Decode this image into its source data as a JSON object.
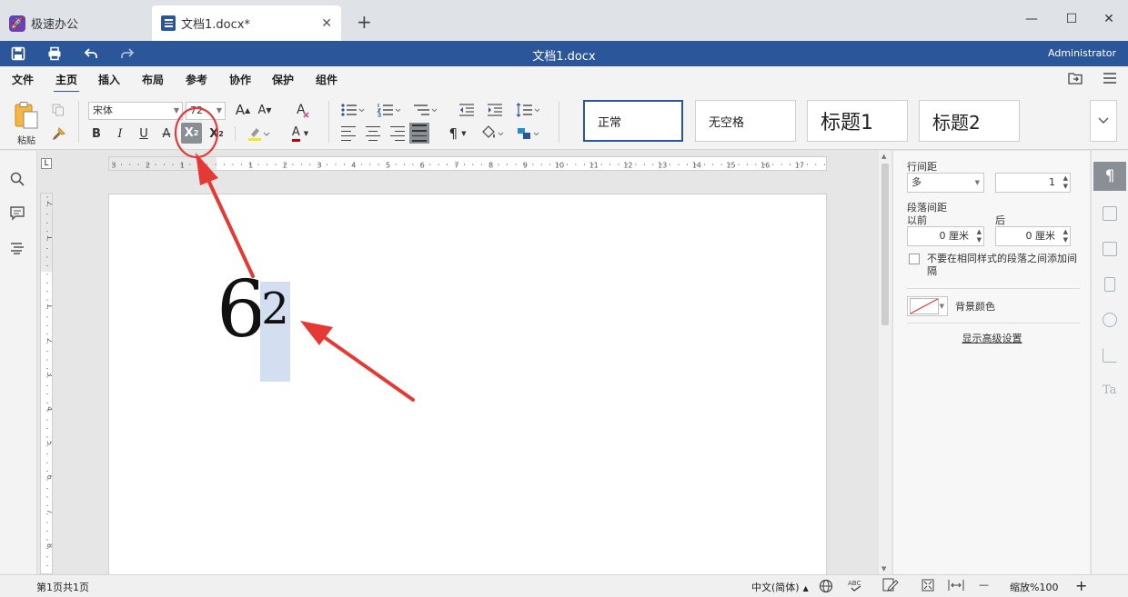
{
  "tabs": {
    "app_title": "极速办公",
    "app_logo_glyph": "🚀",
    "doc_title": "文档1.docx*",
    "close_glyph": "✕",
    "new_tab_glyph": "+"
  },
  "window": {
    "title": "文档1.docx",
    "user": "Administrator",
    "minimize_glyph": "—",
    "maximize_glyph": "☐",
    "close_glyph": "✕"
  },
  "menu": {
    "items": [
      "文件",
      "主页",
      "插入",
      "布局",
      "参考",
      "协作",
      "保护",
      "组件"
    ],
    "active": "主页"
  },
  "ribbon": {
    "paste_label": "粘贴",
    "font_name": "宋体",
    "font_size": "72",
    "grow_font": "A",
    "shrink_font": "A",
    "bold": "B",
    "italic": "I",
    "underline": "U",
    "strike": "A",
    "superscript_base": "X",
    "superscript_exp": "2",
    "subscript_base": "X",
    "subscript_exp": "2",
    "font_color_glyph": "A",
    "pilcrow": "¶",
    "styles": [
      "正常",
      "无空格",
      "标题1",
      "标题2"
    ]
  },
  "document": {
    "base_text": "6",
    "superscript_text": "2"
  },
  "panel": {
    "line_spacing_label": "行间距",
    "line_spacing_mode": "多",
    "line_spacing_value": "1",
    "paragraph_spacing_label": "段落间距",
    "before_label": "以前",
    "after_label": "后",
    "before_value": "0 厘米",
    "after_value": "0 厘米",
    "no_space_checkbox_label": "不要在相同样式的段落之间添加间隔",
    "bg_color_label": "背景颜色",
    "advanced_link": "显示高级设置"
  },
  "status": {
    "page_info": "第1页共1页",
    "language": "中文(简体)",
    "zoom_label": "缩放%100",
    "zoom_minus": "—",
    "zoom_plus": "+"
  },
  "ruler": {
    "h_labels": [
      "3",
      "2",
      "1",
      "1",
      "2",
      "3",
      "4",
      "5",
      "6",
      "7",
      "8",
      "9",
      "10",
      "11",
      "12",
      "13",
      "14",
      "15",
      "16",
      "17"
    ],
    "v_labels": [
      "2",
      "1",
      "1",
      "2",
      "3",
      "4",
      "5",
      "6",
      "7",
      "8"
    ]
  },
  "colors": {
    "accent": "#2b579a",
    "annotation": "#e53935",
    "selection": "#d3def0"
  }
}
